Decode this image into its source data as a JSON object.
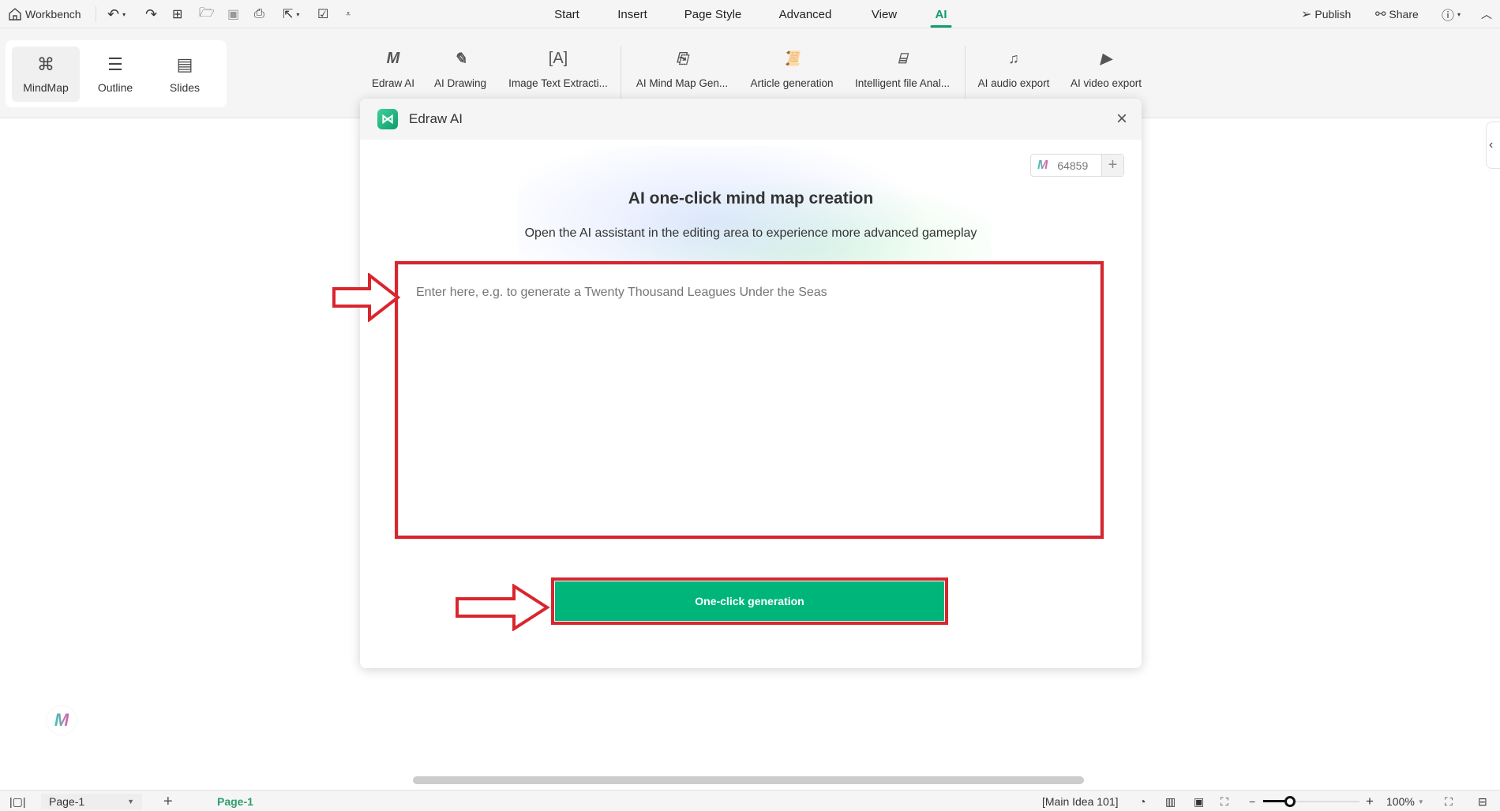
{
  "topbar": {
    "workbench": "Workbench",
    "tabs": [
      {
        "label": "Start"
      },
      {
        "label": "Insert"
      },
      {
        "label": "Page Style"
      },
      {
        "label": "Advanced"
      },
      {
        "label": "View"
      },
      {
        "label": "AI",
        "active": true
      }
    ],
    "publish": "Publish",
    "share": "Share"
  },
  "modes": [
    {
      "label": "MindMap",
      "selected": true
    },
    {
      "label": "Outline"
    },
    {
      "label": "Slides"
    }
  ],
  "ribbon": [
    {
      "label": "Edraw AI",
      "icon": "edraw-ai-icon"
    },
    {
      "label": "AI Drawing",
      "icon": "ai-drawing-icon"
    },
    {
      "label": "Image Text Extracti...",
      "icon": "image-text-icon"
    },
    {
      "label": "AI Mind Map Gen...",
      "icon": "ai-mindmap-icon"
    },
    {
      "label": "Article generation",
      "icon": "article-icon"
    },
    {
      "label": "Intelligent file Anal...",
      "icon": "file-analysis-icon"
    },
    {
      "label": "AI audio export",
      "icon": "audio-icon"
    },
    {
      "label": "AI video export",
      "icon": "video-icon"
    }
  ],
  "dialog": {
    "title": "Edraw AI",
    "credits": "64859",
    "heading": "AI one-click mind map creation",
    "subheading": "Open the AI assistant in the editing area to experience more advanced gameplay",
    "placeholder": "Enter here, e.g. to generate a Twenty Thousand Leagues Under the Seas",
    "button": "One-click generation"
  },
  "statusbar": {
    "page_select": "Page-1",
    "page_tab": "Page-1",
    "selection": "[Main Idea 101]",
    "zoom": "100%",
    "zoom_level_percent": 100
  },
  "colors": {
    "accent": "#0f9d6b",
    "button": "#00b57a",
    "highlight": "#d9262e"
  }
}
